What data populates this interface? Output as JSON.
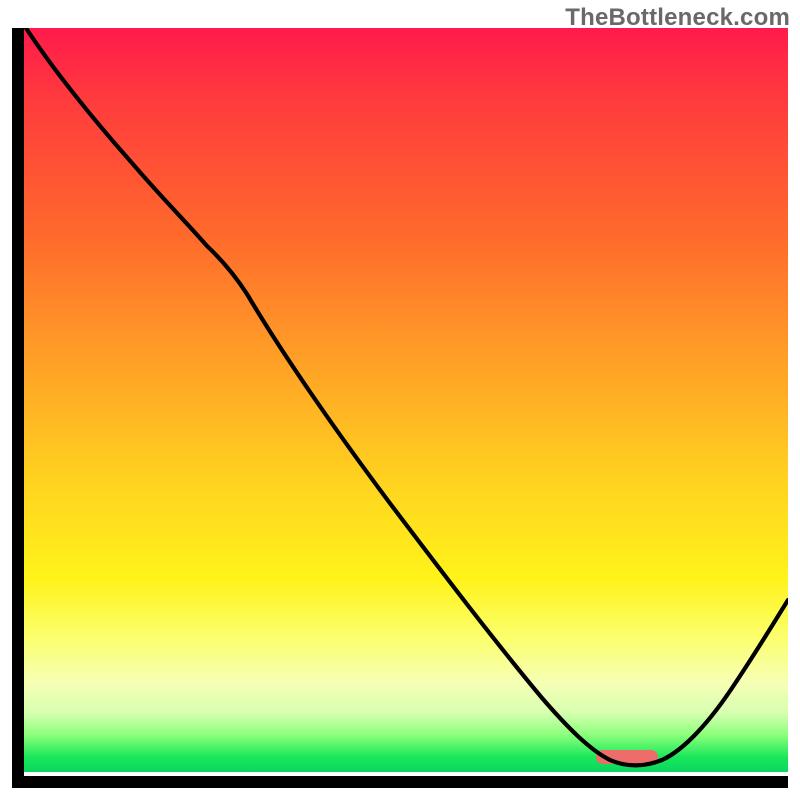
{
  "watermark": "TheBottleneck.com",
  "colors": {
    "watermark_text": "#696969",
    "axis": "#000000",
    "curve": "#000000",
    "marker": "#ed6d6a",
    "gradient_stops": [
      "#ff1a4b",
      "#ff3c3d",
      "#ff6a2c",
      "#ffa126",
      "#ffd61f",
      "#fff31a",
      "#fbff6e",
      "#f6ffb4",
      "#d7ffb0",
      "#8dff7c",
      "#1ae85a",
      "#0ad560"
    ]
  },
  "marker": {
    "x_start": 0.76,
    "x_end": 0.84,
    "y": 0.975
  },
  "chart_data": {
    "type": "line",
    "title": "",
    "xlabel": "",
    "ylabel": "",
    "xlim": [
      0,
      1
    ],
    "ylim": [
      0,
      1
    ],
    "grid": false,
    "annotations": [
      "TheBottleneck.com"
    ],
    "series": [
      {
        "name": "bottleneck-curve",
        "x": [
          0.0,
          0.05,
          0.1,
          0.15,
          0.2,
          0.23,
          0.27,
          0.32,
          0.4,
          0.5,
          0.6,
          0.68,
          0.74,
          0.78,
          0.82,
          0.86,
          0.9,
          0.95,
          1.0
        ],
        "y": [
          1.0,
          0.94,
          0.88,
          0.83,
          0.78,
          0.74,
          0.7,
          0.63,
          0.52,
          0.39,
          0.26,
          0.15,
          0.07,
          0.02,
          0.01,
          0.03,
          0.08,
          0.14,
          0.22
        ]
      }
    ],
    "optimum_range_x": [
      0.76,
      0.84
    ]
  }
}
